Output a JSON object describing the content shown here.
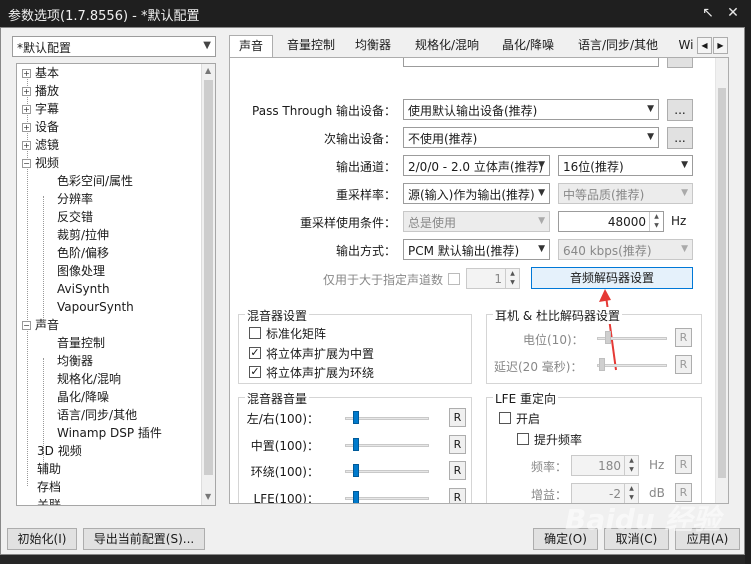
{
  "window": {
    "title": "参数选项(1.7.8556) - *默认配置",
    "pin_icon": "pin-icon",
    "close_icon": "close-icon"
  },
  "preset": {
    "value": "*默认配置"
  },
  "tree": {
    "items": [
      {
        "label": "基本",
        "expand": "+"
      },
      {
        "label": "播放",
        "expand": "+"
      },
      {
        "label": "字幕",
        "expand": "+"
      },
      {
        "label": "设备",
        "expand": "+"
      },
      {
        "label": "滤镜",
        "expand": "+"
      },
      {
        "label": "视频",
        "expand": "−"
      },
      {
        "label": "色彩空间/属性"
      },
      {
        "label": "分辨率"
      },
      {
        "label": "反交错"
      },
      {
        "label": "裁剪/拉伸"
      },
      {
        "label": "色阶/偏移"
      },
      {
        "label": "图像处理"
      },
      {
        "label": "AviSynth"
      },
      {
        "label": "VapourSynth"
      },
      {
        "label": "声音",
        "expand": "−"
      },
      {
        "label": "音量控制"
      },
      {
        "label": "均衡器"
      },
      {
        "label": "规格化/混响"
      },
      {
        "label": "晶化/降噪"
      },
      {
        "label": "语言/同步/其他"
      },
      {
        "label": "Winamp DSP 插件"
      },
      {
        "label": "3D 视频"
      },
      {
        "label": "辅助"
      },
      {
        "label": "存档"
      },
      {
        "label": "关联"
      }
    ]
  },
  "tabs": [
    "声音",
    "音量控制",
    "均衡器",
    "规格化/混响",
    "晶化/降噪",
    "语言/同步/其他",
    "Wi"
  ],
  "output": {
    "passthrough_label": "Pass Through 输出设备：",
    "passthrough_value": "使用默认输出设备(推荐)",
    "secondary_label": "次输出设备：",
    "secondary_value": "不使用(推荐)",
    "browse": "...",
    "channel_label": "输出通道：",
    "channel_value": "2/0/0 - 2.0 立体声(推荐)",
    "bits_value": "16位(推荐)",
    "resample_label": "重采样率：",
    "resample_value": "源(输入)作为输出(推荐)",
    "quality_value": "中等品质(推荐)",
    "resample_cond_label": "重采样使用条件：",
    "resample_cond_value": "总是使用",
    "rate_value": "48000",
    "hz": "Hz",
    "mode_label": "输出方式：",
    "mode_value": "PCM 默认输出(推荐)",
    "kbps_value": "640 kbps(推荐)",
    "only_when_label": "仅用于大于指定声道数",
    "channels_min": "1",
    "decoder_button": "音频解码器设置"
  },
  "mixer": {
    "title": "混音器设置",
    "normalize": "标准化矩阵",
    "to_center": "将立体声扩展为中置",
    "to_surround": "将立体声扩展为环绕"
  },
  "headphone": {
    "title": "耳机 & 杜比解码器设置",
    "level_label": "电位(10)：",
    "delay_label": "延迟(20 毫秒)：",
    "reset": "R"
  },
  "mixer_volume": {
    "title": "混音器音量",
    "rows": [
      {
        "label": "左/右(100)：",
        "value": 100
      },
      {
        "label": "中置(100)：",
        "value": 100
      },
      {
        "label": "环绕(100)：",
        "value": 100
      },
      {
        "label": "LFE(100)：",
        "value": 100
      }
    ],
    "reset": "R"
  },
  "lfe": {
    "title": "LFE 重定向",
    "enable": "开启",
    "boost": "提升频率",
    "freq_label": "频率：",
    "freq_value": "180",
    "freq_unit": "Hz",
    "gain_label": "增益：",
    "gain_value": "-2",
    "gain_unit": "dB",
    "reset": "R"
  },
  "footer": {
    "init": "初始化(I)",
    "export": "导出当前配置(S)...",
    "ok": "确定(O)",
    "cancel": "取消(C)",
    "apply": "应用(A)"
  },
  "watermark": "Baidu 经验",
  "colors": {
    "accent": "#007acc",
    "arrow": "#e53935",
    "titlebar": "#1f1f1f"
  }
}
